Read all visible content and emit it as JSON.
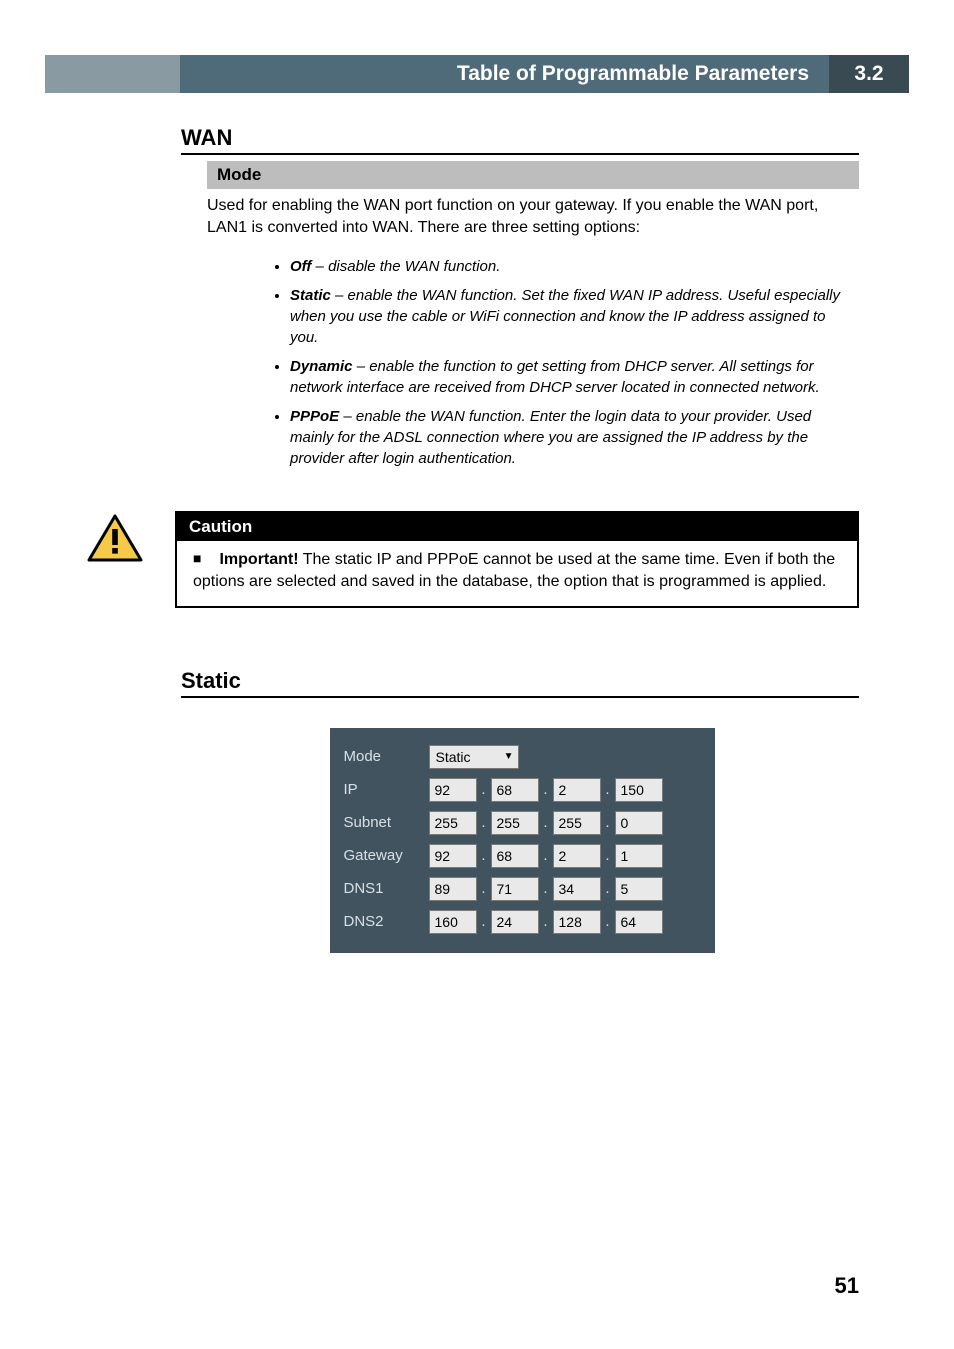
{
  "header": {
    "title": "Table of Programmable Parameters",
    "section": "3.2"
  },
  "wan": {
    "heading": "WAN",
    "mode_heading": "Mode",
    "intro": "Used for enabling the WAN port function on your gateway. If you enable the WAN port, LAN1 is converted into WAN. There are three setting options:",
    "options": [
      {
        "name": "Off",
        "desc": " – disable the WAN function."
      },
      {
        "name": "Static",
        "desc": " – enable the WAN function. Set the fixed WAN IP address. Useful especially when you use the cable or WiFi connection and know the IP address assigned to you."
      },
      {
        "name": "Dynamic",
        "desc": " – enable the function to get setting from DHCP server. All settings for network interface are received from DHCP server located in connected network."
      },
      {
        "name": "PPPoE",
        "desc": " – enable the WAN function. Enter the login data to your provider. Used mainly for the ADSL connection where you are assigned the IP address by the provider after login authentication."
      }
    ]
  },
  "caution": {
    "heading": "Caution",
    "important": "Important!",
    "body": " The static IP and PPPoE cannot be used at the same time. Even if both the options are selected and saved in the database, the option that is programmed is applied."
  },
  "static": {
    "heading": "Static",
    "ui": {
      "mode_label": "Mode",
      "mode_value": "Static",
      "rows": [
        {
          "label": "IP",
          "octets": [
            "92",
            "68",
            "2",
            "150"
          ]
        },
        {
          "label": "Subnet",
          "octets": [
            "255",
            "255",
            "255",
            "0"
          ]
        },
        {
          "label": "Gateway",
          "octets": [
            "92",
            "68",
            "2",
            "1"
          ]
        },
        {
          "label": "DNS1",
          "octets": [
            "89",
            "71",
            "34",
            "5"
          ]
        },
        {
          "label": "DNS2",
          "octets": [
            "160",
            "24",
            "128",
            "64"
          ]
        }
      ]
    }
  },
  "page_number": "51"
}
